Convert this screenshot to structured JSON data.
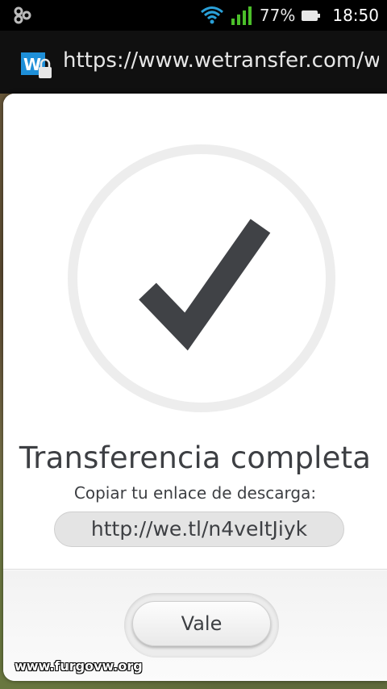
{
  "status_bar": {
    "left_icon": "notification-icon",
    "wifi_icon": "wifi-icon",
    "signal_icon": "signal-icon",
    "battery_percent": "77%",
    "battery_icon": "battery-icon",
    "time": "18:50"
  },
  "browser": {
    "site_icon": "wetransfer-secure-icon",
    "url": "https://www.wetransfer.com/we"
  },
  "dialog": {
    "check_icon": "checkmark-icon",
    "title": "Transferencia completa",
    "subtitle": "Copiar tu enlace de descarga:",
    "link": "http://we.tl/n4veItJiyk",
    "button_label": "Vale"
  },
  "watermark": "www.furgovw.org",
  "colors": {
    "text": "#3d3f43",
    "check": "#404246",
    "circle_ring": "#ededed",
    "wetransfer_blue": "#1e8fd8"
  }
}
